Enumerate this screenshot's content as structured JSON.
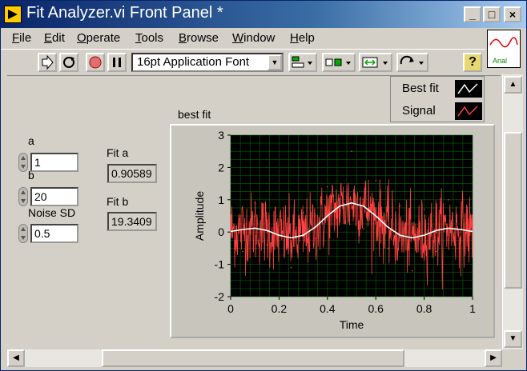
{
  "window": {
    "title": "Fit Analyzer.vi Front Panel *",
    "buttons": [
      "_",
      "□",
      "×"
    ]
  },
  "menu": [
    "File",
    "Edit",
    "Operate",
    "Tools",
    "Browse",
    "Window",
    "Help"
  ],
  "toolbar": {
    "font": "16pt Application Font",
    "help_label": "?"
  },
  "vi_icon": {
    "label": "Anal"
  },
  "controls": {
    "a": {
      "label": "a",
      "value": "1"
    },
    "b": {
      "label": "b",
      "value": "20"
    },
    "noise": {
      "label": "Noise SD",
      "value": "0.5"
    }
  },
  "indicators": {
    "fit_a": {
      "label": "Fit a",
      "value": "0.90589"
    },
    "fit_b": {
      "label": "Fit b",
      "value": "19.3409"
    }
  },
  "graph": {
    "label": "best fit",
    "legend": [
      {
        "name": "Best fit",
        "color": "#ffffff"
      },
      {
        "name": "Signal",
        "color": "#ff4040"
      }
    ]
  },
  "chart_data": {
    "type": "line",
    "xlabel": "Time",
    "ylabel": "Amplitude",
    "xlim": [
      0,
      1
    ],
    "ylim": [
      -2,
      3
    ],
    "x_ticks": [
      "0",
      "0.2",
      "0.4",
      "0.6",
      "0.8",
      "1"
    ],
    "y_ticks": [
      "3",
      "2",
      "1",
      "0",
      "-1",
      "-2"
    ],
    "grid": true,
    "series": [
      {
        "name": "Best fit",
        "color": "#ffffff",
        "x": [
          0,
          0.05,
          0.1,
          0.15,
          0.2,
          0.25,
          0.3,
          0.35,
          0.4,
          0.45,
          0.5,
          0.55,
          0.6,
          0.65,
          0.7,
          0.75,
          0.8,
          0.85,
          0.9,
          0.95,
          1
        ],
        "values": [
          0.02,
          0.08,
          0.12,
          0.05,
          -0.1,
          -0.18,
          -0.1,
          0.15,
          0.5,
          0.8,
          0.9,
          0.8,
          0.5,
          0.15,
          -0.1,
          -0.18,
          -0.1,
          0.05,
          0.12,
          0.08,
          0.02
        ]
      },
      {
        "name": "Signal",
        "color": "#ff4040",
        "x": [
          0,
          0.05,
          0.1,
          0.15,
          0.2,
          0.25,
          0.3,
          0.35,
          0.4,
          0.45,
          0.5,
          0.55,
          0.6,
          0.65,
          0.7,
          0.75,
          0.8,
          0.85,
          0.9,
          0.95,
          1
        ],
        "values": [
          0.3,
          -0.6,
          0.9,
          -0.4,
          0.2,
          -1.1,
          0.6,
          -0.2,
          1.4,
          0.3,
          2.5,
          0.1,
          1.6,
          -0.5,
          0.8,
          -1.2,
          0.7,
          -0.6,
          1.0,
          -0.3,
          0.2
        ],
        "noise_sd": 0.5
      }
    ]
  }
}
